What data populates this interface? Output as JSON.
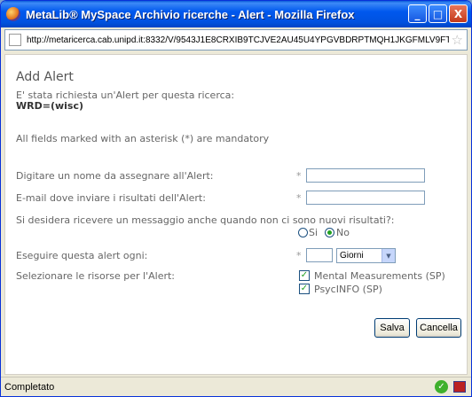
{
  "window": {
    "title": "MetaLib® MySpace Archivio ricerche - Alert - Mozilla Firefox",
    "minimize_label": "_",
    "maximize_label": "□",
    "close_label": "X"
  },
  "address": {
    "url": "http://metaricerca.cab.unipd.it:8332/V/9543J1E8CRXIB9TCJVE2AU45U4YPGVBDRPTMQH1JKGFMLV9FTF"
  },
  "page": {
    "title": "Add Alert",
    "intro": "E' stata richiesta un'Alert per questa ricerca:",
    "query": "WRD=(wisc)",
    "mandatory_note": "All fields marked with an asterisk (*) are mandatory"
  },
  "form": {
    "asterisk": "*",
    "name_label": "Digitare un nome da assegnare all'Alert:",
    "name_value": "",
    "email_label": "E-mail dove inviare i risultati dell'Alert:",
    "email_value": "",
    "notify_label": "Si desidera ricevere un messaggio anche quando non ci sono nuovi risultati?:",
    "radio_yes_label": "Si",
    "radio_no_label": "No",
    "radio_selected": "No",
    "frequency_label": "Eseguire questa alert ogni:",
    "frequency_value": "",
    "frequency_unit": "Giorni",
    "resources_label": "Selezionare le risorse per l'Alert:",
    "resources": [
      {
        "label": "Mental Measurements (SP)",
        "checked": true
      },
      {
        "label": "PsycINFO (SP)",
        "checked": true
      }
    ],
    "save_label": "Salva",
    "cancel_label": "Cancella"
  },
  "status": {
    "text": "Completato"
  },
  "colors": {
    "titlebar": "#0058ee",
    "check_green": "#21a121"
  }
}
